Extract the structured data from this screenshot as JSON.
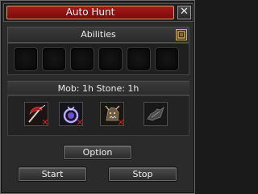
{
  "window": {
    "title": "Auto Hunt",
    "close_glyph": "✕"
  },
  "abilities": {
    "label": "Abilities",
    "toggle_icon": "gold-square-toggle-icon",
    "slots": [
      "",
      "",
      "",
      "",
      "",
      ""
    ]
  },
  "status": {
    "text": "Mob: 1h Stone: 1h"
  },
  "items": [
    {
      "icon": "red-scythe-icon",
      "disabled": true
    },
    {
      "icon": "purple-ring-orb-icon",
      "disabled": true
    },
    {
      "icon": "beast-head-icon",
      "disabled": true
    },
    {
      "icon": "grey-wolf-icon",
      "disabled": false
    }
  ],
  "buttons": {
    "option": "Option",
    "start": "Start",
    "stop": "Stop"
  },
  "colors": {
    "title_red": "#8e1010",
    "accent_gold": "#d8b35a",
    "disabled_x": "#e31c1c"
  }
}
